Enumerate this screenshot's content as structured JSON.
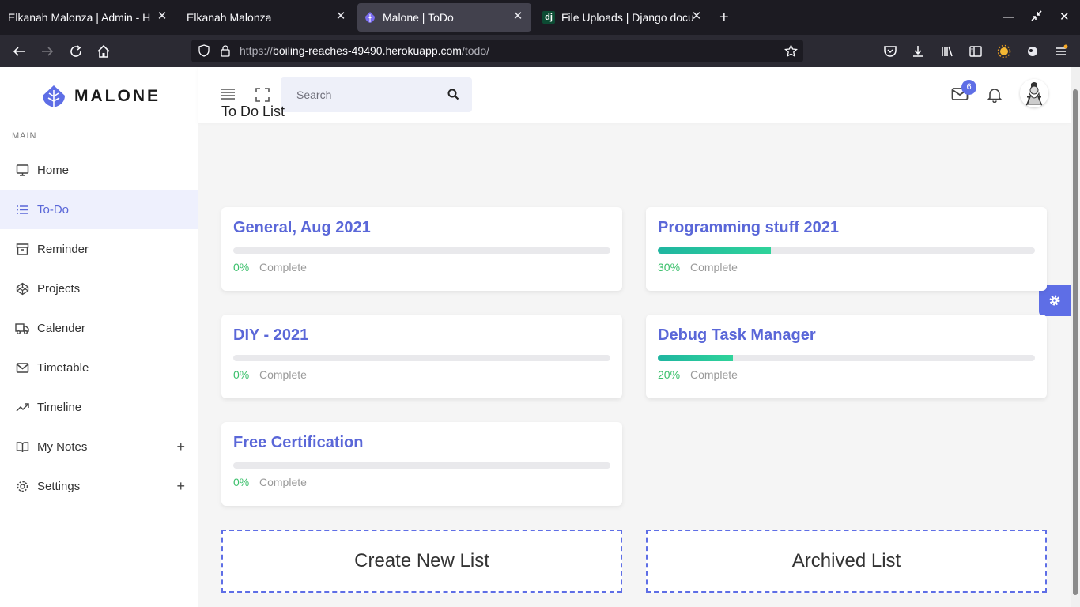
{
  "browser": {
    "tabs": [
      {
        "title": "Elkanah Malonza | Admin - Ho",
        "icon": "none"
      },
      {
        "title": "Elkanah Malonza",
        "icon": "none"
      },
      {
        "title": "Malone | ToDo",
        "icon": "malone-leaf"
      },
      {
        "title": "File Uploads | Django docu",
        "icon": "dj",
        "icon_text": "dj"
      }
    ],
    "url_prefix": "https://",
    "url_host": "boiling-reaches-49490.herokuapp.com",
    "url_path": "/todo/"
  },
  "brand": {
    "name": "MALONE",
    "accent": "#5a67d8"
  },
  "sidebar": {
    "section": "MAIN",
    "items": [
      {
        "label": "Home",
        "icon": "monitor-icon"
      },
      {
        "label": "To-Do",
        "icon": "list-icon"
      },
      {
        "label": "Reminder",
        "icon": "archive-icon"
      },
      {
        "label": "Projects",
        "icon": "codepen-icon"
      },
      {
        "label": "Calender",
        "icon": "truck-icon"
      },
      {
        "label": "Timetable",
        "icon": "mail-icon"
      },
      {
        "label": "Timeline",
        "icon": "trending-up-icon"
      },
      {
        "label": "My Notes",
        "icon": "book-icon",
        "expand": "+"
      },
      {
        "label": "Settings",
        "icon": "settings-icon",
        "expand": "+"
      }
    ]
  },
  "header": {
    "search_placeholder": "Search",
    "mail_badge": "6"
  },
  "main": {
    "title": "To Do List",
    "lists": [
      {
        "title": "General, Aug 2021",
        "percent": "0%",
        "progress": 0,
        "status": "Complete"
      },
      {
        "title": "Programming stuff 2021",
        "percent": "30%",
        "progress": 30,
        "status": "Complete"
      },
      {
        "title": "DIY - 2021",
        "percent": "0%",
        "progress": 0,
        "status": "Complete"
      },
      {
        "title": "Debug Task Manager",
        "percent": "20%",
        "progress": 20,
        "status": "Complete"
      },
      {
        "title": "Free Certification",
        "percent": "0%",
        "progress": 0,
        "status": "Complete"
      }
    ],
    "create_label": "Create New List",
    "archived_label": "Archived List"
  }
}
